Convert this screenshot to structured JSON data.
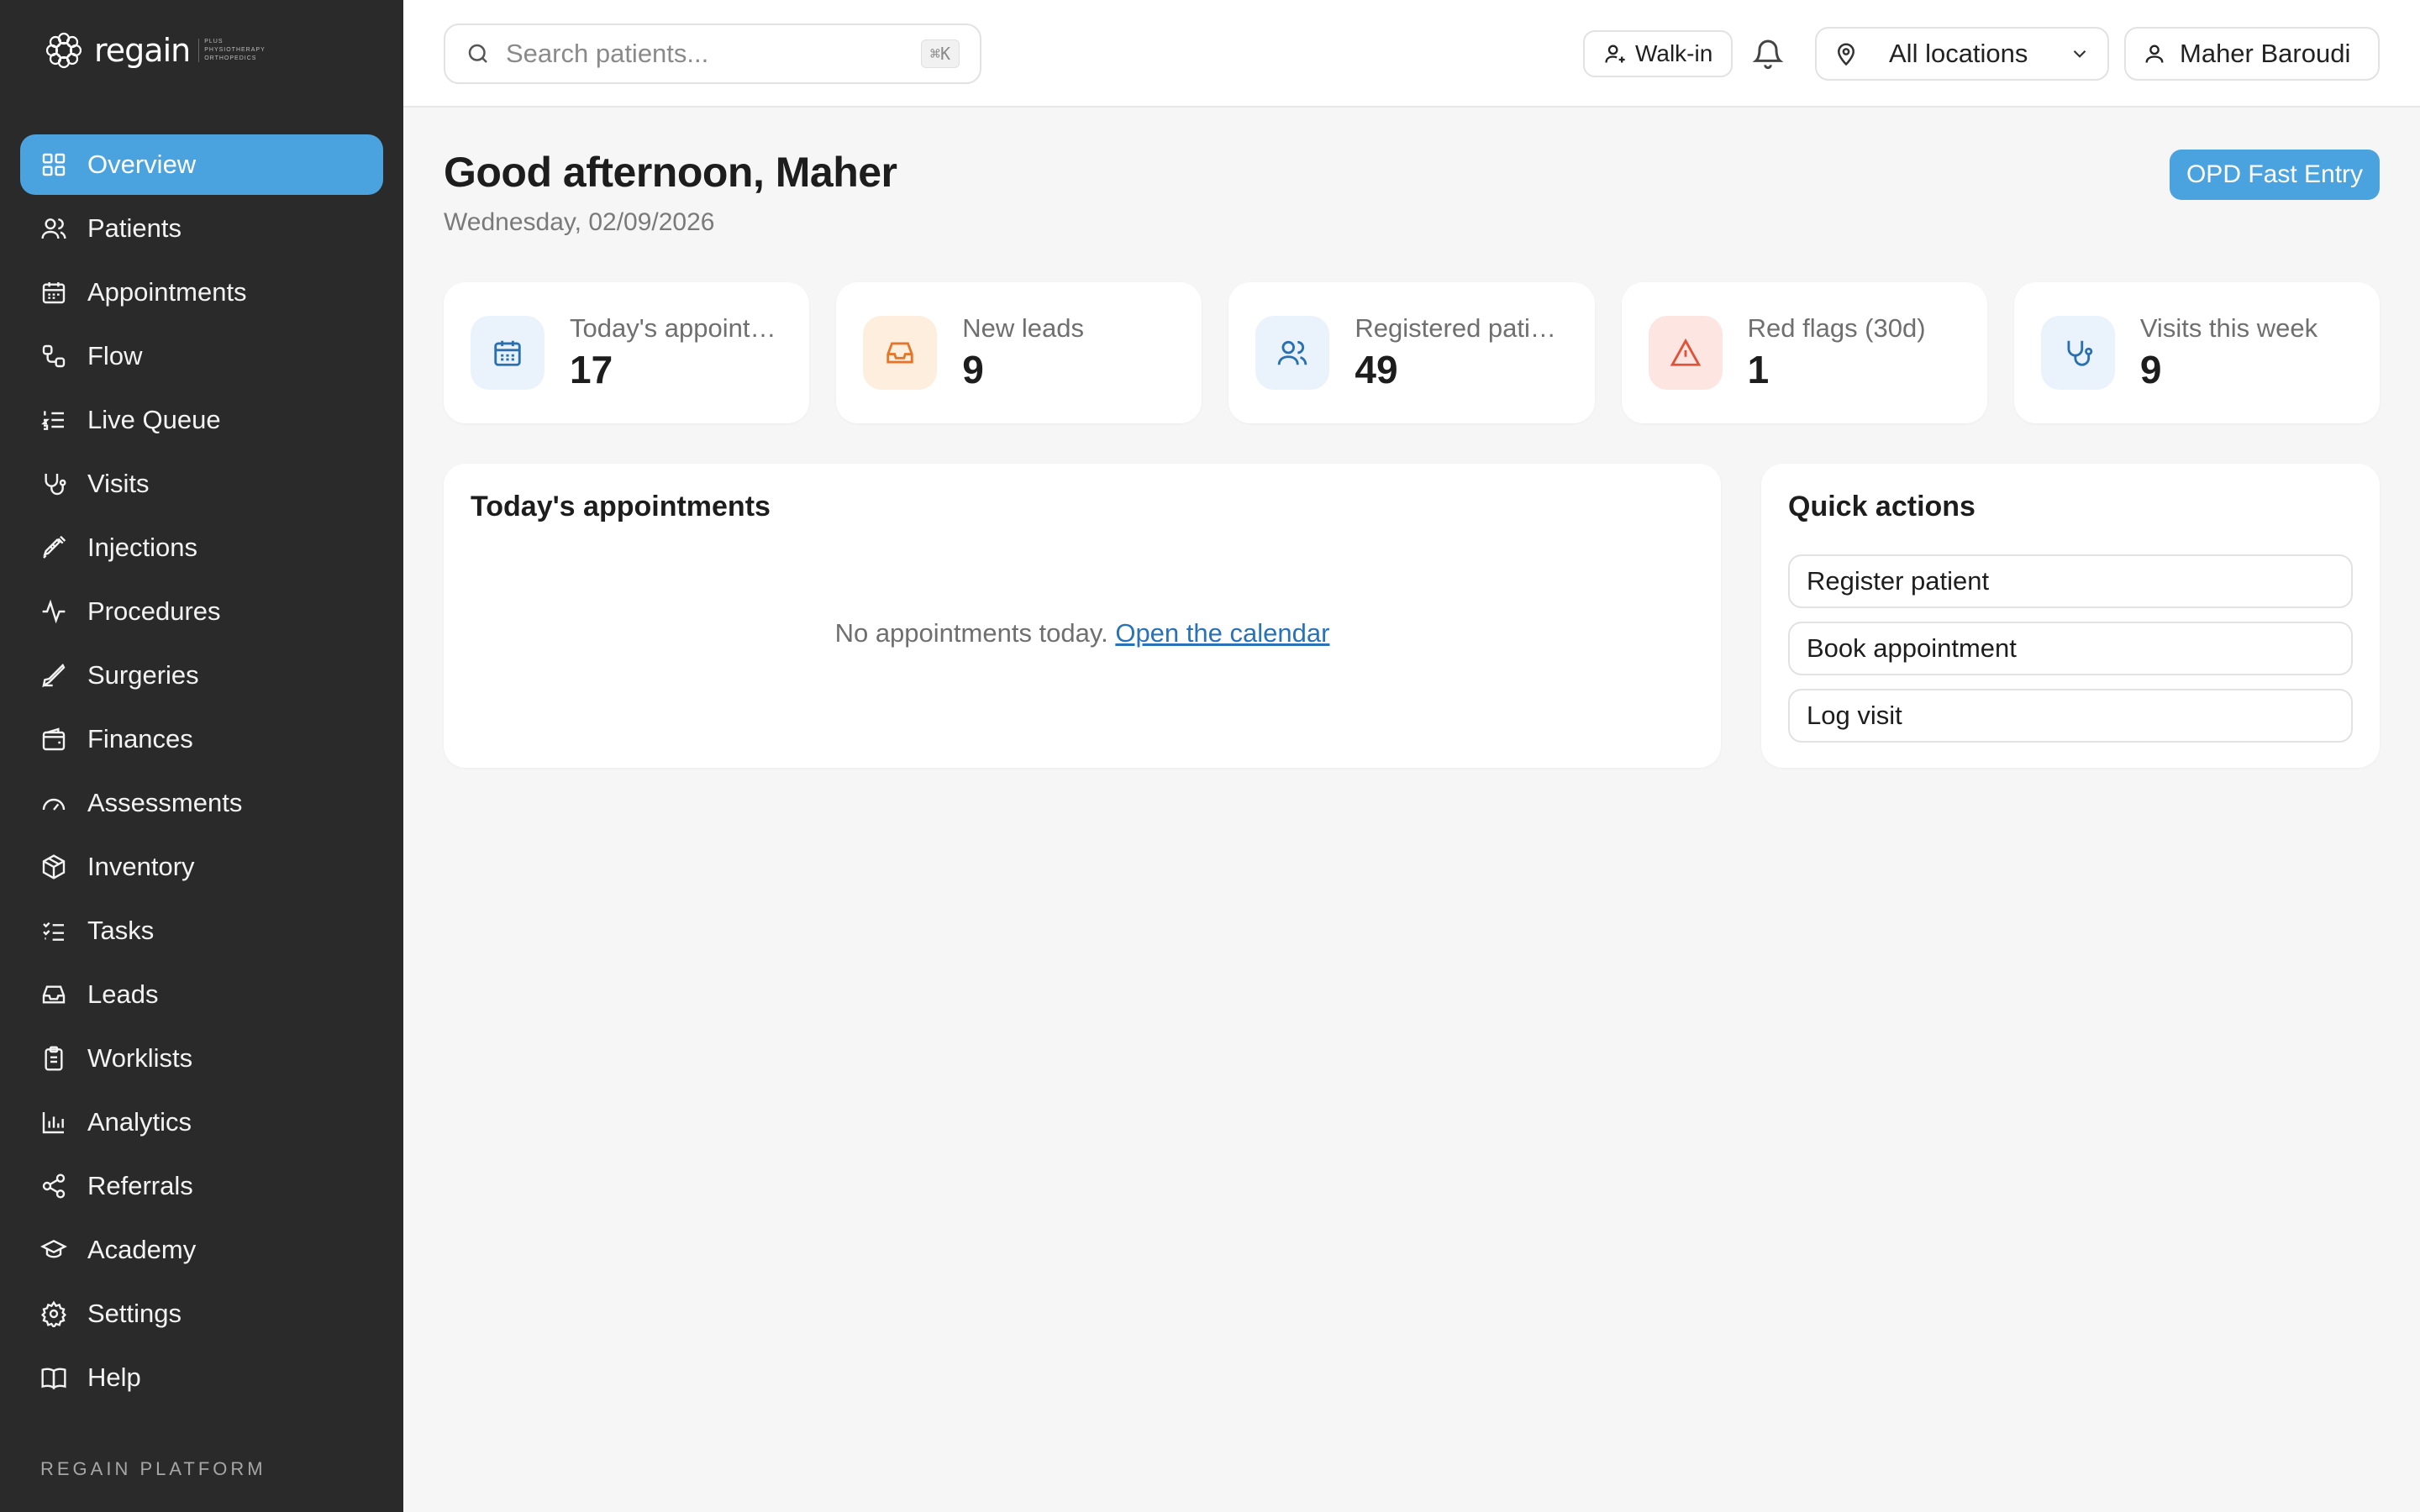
{
  "brand": {
    "name": "regain",
    "subtitle_lines": [
      "PLUS",
      "PHYSIOTHERAPY",
      "ORTHOPEDICS"
    ]
  },
  "sidebar": {
    "items": [
      {
        "label": "Overview",
        "icon": "grid-icon",
        "active": true
      },
      {
        "label": "Patients",
        "icon": "users-icon"
      },
      {
        "label": "Appointments",
        "icon": "calendar-icon"
      },
      {
        "label": "Flow",
        "icon": "flow-icon"
      },
      {
        "label": "Live Queue",
        "icon": "list-ordered-icon"
      },
      {
        "label": "Visits",
        "icon": "stethoscope-icon"
      },
      {
        "label": "Injections",
        "icon": "syringe-icon"
      },
      {
        "label": "Procedures",
        "icon": "activity-icon"
      },
      {
        "label": "Surgeries",
        "icon": "scalpel-icon"
      },
      {
        "label": "Finances",
        "icon": "wallet-icon"
      },
      {
        "label": "Assessments",
        "icon": "gauge-icon"
      },
      {
        "label": "Inventory",
        "icon": "package-icon"
      },
      {
        "label": "Tasks",
        "icon": "checklist-icon"
      },
      {
        "label": "Leads",
        "icon": "inbox-icon"
      },
      {
        "label": "Worklists",
        "icon": "clipboard-icon"
      },
      {
        "label": "Analytics",
        "icon": "bar-chart-icon"
      },
      {
        "label": "Referrals",
        "icon": "share-icon"
      },
      {
        "label": "Academy",
        "icon": "graduation-cap-icon"
      },
      {
        "label": "Settings",
        "icon": "gear-icon"
      },
      {
        "label": "Help",
        "icon": "book-icon"
      }
    ],
    "footer": "REGAIN PLATFORM"
  },
  "topbar": {
    "search_placeholder": "Search patients...",
    "search_shortcut": "⌘K",
    "walkin_label": "Walk-in",
    "location_label": "All locations",
    "user_name": "Maher Baroudi"
  },
  "main": {
    "greeting": "Good afternoon, Maher",
    "date": "Wednesday, 02/09/2026",
    "opd_button": "OPD Fast Entry"
  },
  "stats": [
    {
      "label": "Today's appointments",
      "value": "17",
      "icon": "calendar-icon",
      "accent": "#2a6fb0",
      "bg": "#eaf3fb"
    },
    {
      "label": "New leads",
      "value": "9",
      "icon": "inbox-icon",
      "accent": "#e2762a",
      "bg": "#fdeedd"
    },
    {
      "label": "Registered patients",
      "value": "49",
      "icon": "users-icon",
      "accent": "#2a6fb0",
      "bg": "#eaf3fb"
    },
    {
      "label": "Red flags (30d)",
      "value": "1",
      "icon": "alert-triangle-icon",
      "accent": "#e0533a",
      "bg": "#fde6e2"
    },
    {
      "label": "Visits this week",
      "value": "9",
      "icon": "stethoscope-icon",
      "accent": "#2a6fb0",
      "bg": "#eaf3fb"
    }
  ],
  "appointments_card": {
    "title": "Today's appointments",
    "empty_text": "No appointments today.",
    "empty_link": "Open the calendar"
  },
  "quick_actions": {
    "title": "Quick actions",
    "items": [
      "Register patient",
      "Book appointment",
      "Log visit"
    ]
  },
  "colors": {
    "sidebar_bg": "#2a2a2a",
    "accent": "#4aa3df",
    "link": "#2a72b8",
    "page_bg": "#f6f6f6"
  }
}
